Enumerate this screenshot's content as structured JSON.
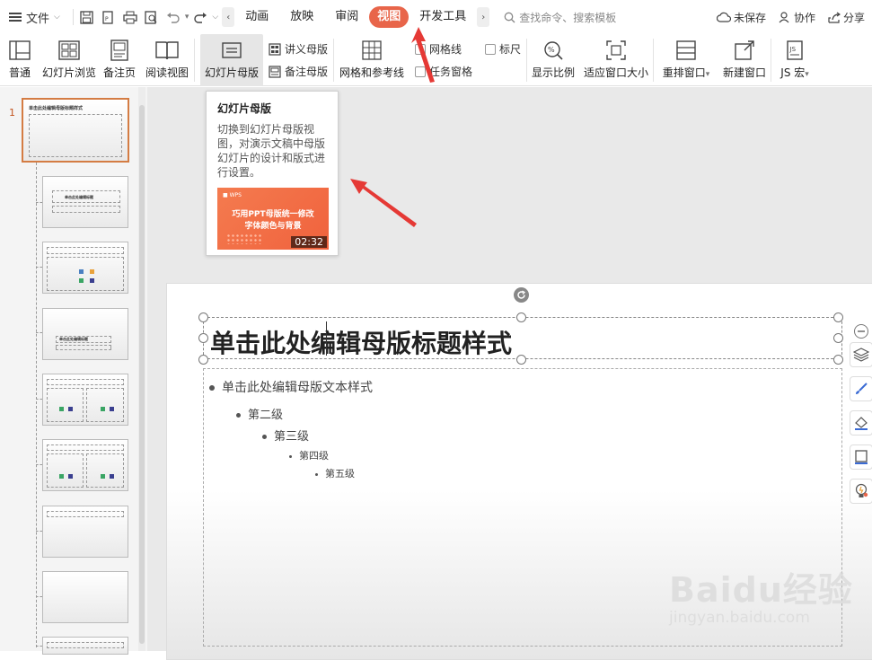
{
  "menubar": {
    "file_label": "文件",
    "tabs": [
      "动画",
      "放映",
      "审阅",
      "视图",
      "开发工具"
    ],
    "active_tab": "视图",
    "search_placeholder": "查找命令、搜索模板",
    "unsaved": "未保存",
    "collab": "协作",
    "share": "分享"
  },
  "ribbon": {
    "normal": "普通",
    "slide_browse": "幻灯片浏览",
    "notes_page": "备注页",
    "reading_view": "阅读视图",
    "slide_master": "幻灯片母版",
    "handout_master": "讲义母版",
    "notes_master": "备注母版",
    "grid_guides": "网格和参考线",
    "gridlines": "网格线",
    "ruler": "标尺",
    "task_pane": "任务窗格",
    "zoom": "显示比例",
    "fit_window": "适应窗口大小",
    "arrange": "重排窗口",
    "new_window": "新建窗口",
    "js_macro": "JS 宏"
  },
  "tooltip": {
    "title": "幻灯片母版",
    "description": "切换到幻灯片母版视图，对演示文稿中母版幻灯片的设计和版式进行设置。",
    "video_line1": "巧用PPT母版统一修改",
    "video_line2": "字体颜色与背景",
    "video_duration": "02:32"
  },
  "slides": {
    "first_number": "1",
    "thumb_title": "单击此处编辑母版标题样式",
    "thumb2_title": "单击此处编辑标题",
    "thumb4_title": "单击此处编辑标题"
  },
  "slide": {
    "title": "单击此处编辑母版标题样式",
    "levels": [
      "单击此处编辑母版文本样式",
      "第二级",
      "第三级",
      "第四级",
      "第五级"
    ]
  },
  "watermark": {
    "brand": "Baidu经验",
    "url": "jingyan.baidu.com"
  },
  "colors": {
    "accent": "#e8654a",
    "arrow": "#e53935",
    "selected_thumb_border": "#d47c43"
  }
}
